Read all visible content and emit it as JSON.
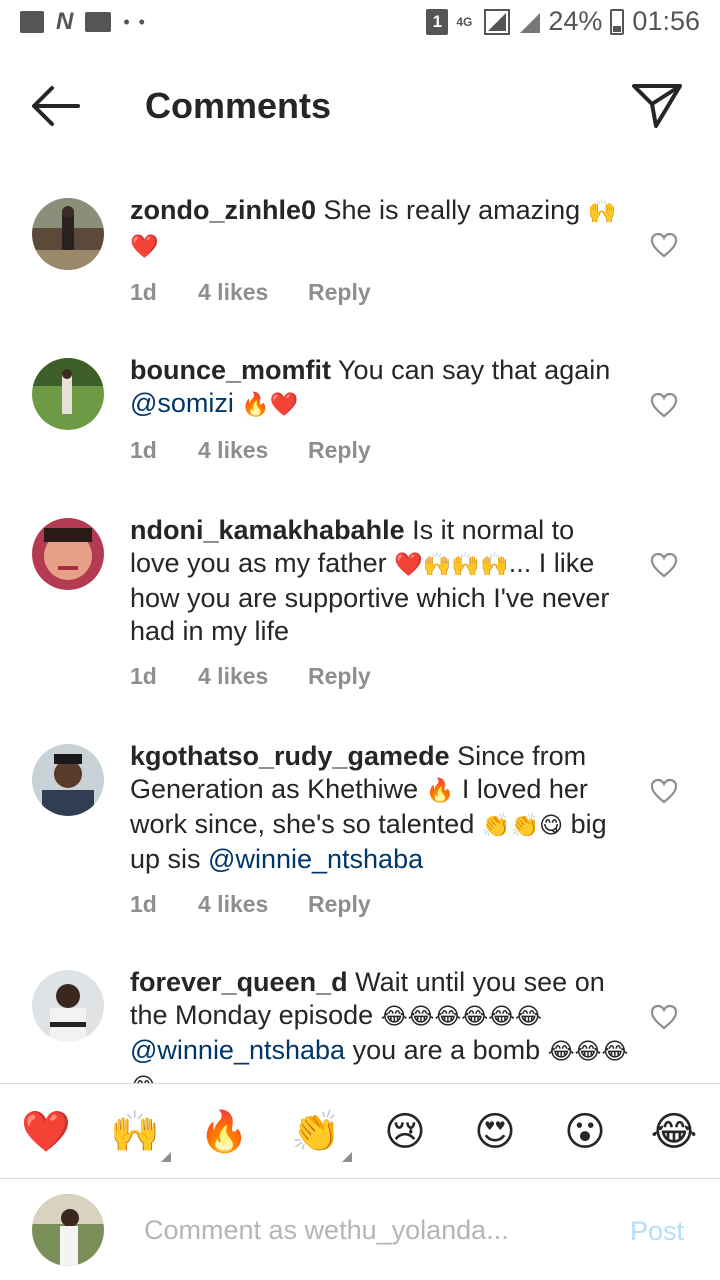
{
  "status_bar": {
    "notification_count": "1",
    "network": "4G",
    "battery": "24%",
    "time": "01:56"
  },
  "header": {
    "title": "Comments"
  },
  "comments": [
    {
      "username": "zondo_zinhle0",
      "text": " She is really amazing ",
      "emoji_after": "🙌 ❤️",
      "time": "1d",
      "likes": "4 likes",
      "reply": "Reply"
    },
    {
      "username": "bounce_momfit",
      "text": " You can say that again ",
      "mention": "@somizi",
      "emoji_after": " 🔥❤️",
      "time": "1d",
      "likes": "4 likes",
      "reply": "Reply"
    },
    {
      "username": "ndoni_kamakhabahle",
      "text": " Is it normal to love you as my father ",
      "emoji_mid": "❤️🙌🙌🙌",
      "text_after": "... I like how you are supportive which I've never had in my life",
      "time": "1d",
      "likes": "4 likes",
      "reply": "Reply"
    },
    {
      "username": "kgothatso_rudy_gamede",
      "text": " Since from Generation as Khethiwe ",
      "emoji_mid": "🔥",
      "text_after": " I loved her work since, she's so talented ",
      "emoji_after": "👏👏😋",
      "text_end": " big up sis ",
      "mention": "@winnie_ntshaba",
      "time": "1d",
      "likes": "4 likes",
      "reply": "Reply"
    },
    {
      "username": "forever_queen_d",
      "text": " Wait until you see on the Monday episode ",
      "emoji_mid": "😂😂😂😂😂😂",
      "mention": "@winnie_ntshaba",
      "text_after": " you are a bomb ",
      "emoji_after": "😂😂😂😂"
    }
  ],
  "emoji_bar": [
    "❤️",
    "🙌",
    "🔥",
    "👏",
    "😢",
    "😍",
    "😮",
    "😂"
  ],
  "composer": {
    "placeholder": "Comment as wethu_yolanda...",
    "post_label": "Post"
  }
}
